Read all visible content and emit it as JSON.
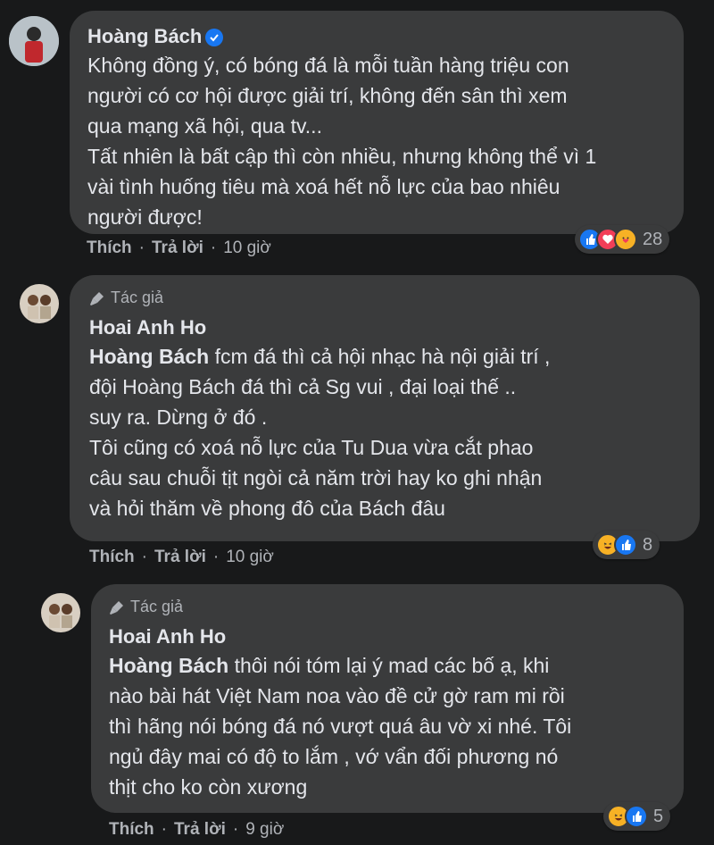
{
  "comments": [
    {
      "name": "Hoàng Bách",
      "verified": true,
      "text": "Không đồng ý, có bóng đá là mỗi tuần hàng triệu con\nngười có cơ hội được giải trí, không đến sân thì xem\nqua mạng xã hội, qua tv...\nTất nhiên là bất cập thì còn nhiều, nhưng không thể vì 1\nvài tình huống tiêu mà xoá hết nỗ lực của bao nhiêu\nngười được!",
      "like_label": "Thích",
      "reply_label": "Trả lời",
      "time": "10 giờ",
      "reactions": [
        "like",
        "love",
        "care"
      ],
      "reaction_count": "28"
    },
    {
      "author_badge": "Tác giả",
      "name": "Hoai Anh Ho",
      "mention": "Hoàng Bách",
      "text": " fcm đá thì cả hội nhạc hà nội giải trí ,\nđội Hoàng Bách đá thì cả Sg vui , đại loại thế ..\nsuy ra. Dừng ở đó .\nTôi cũng có xoá nỗ lực của Tu Dua vừa cắt phao\ncâu sau chuỗi tịt ngòi cả năm trời hay ko ghi nhận\nvà hỏi thăm về phong đô của Bách đâu",
      "like_label": "Thích",
      "reply_label": "Trả lời",
      "time": "10 giờ",
      "reactions": [
        "haha",
        "like"
      ],
      "reaction_count": "8"
    },
    {
      "author_badge": "Tác giả",
      "name": "Hoai Anh Ho",
      "mention": "Hoàng Bách",
      "text": " thôi nói tóm lại ý mad các bố ạ, khi\nnào bài hát Việt Nam noa vào đề cử gờ ram mi rồi\nthì hãng nói bóng đá nó vượt quá âu vờ xi nhé. Tôi\nngủ đây mai có độ to lắm , vớ vẩn đối phương nó\nthịt cho ko còn xương",
      "like_label": "Thích",
      "reply_label": "Trả lời",
      "time": "9 giờ",
      "reactions": [
        "haha",
        "like"
      ],
      "reaction_count": "5"
    }
  ]
}
